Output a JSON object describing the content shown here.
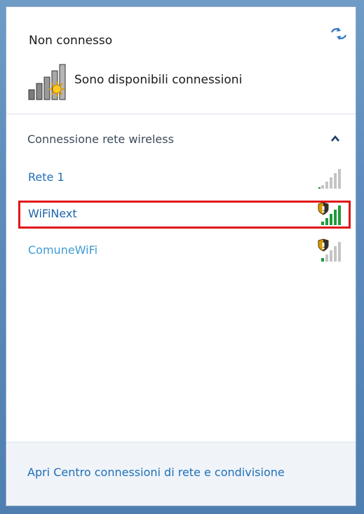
{
  "header": {
    "status": "Non connesso",
    "availability": "Sono disponibili connessioni"
  },
  "section": {
    "title": "Connessione rete wireless"
  },
  "networks": [
    {
      "name": "Rete 1",
      "secured": false,
      "signal_bars": 5,
      "signal_level": 0,
      "selected": false
    },
    {
      "name": "WiFiNext",
      "secured": true,
      "signal_bars": 5,
      "signal_level": 5,
      "selected": true
    },
    {
      "name": "ComuneWiFi",
      "secured": true,
      "signal_bars": 5,
      "signal_level": 1,
      "selected": false
    }
  ],
  "footer": {
    "link": "Apri Centro connessioni di rete e condivisione"
  },
  "colors": {
    "link": "#1e6fb8",
    "highlight": "#e0161a",
    "signal_green": "#1f9a3a",
    "signal_gray": "#c4c4c4",
    "shield": "#d99a00"
  }
}
